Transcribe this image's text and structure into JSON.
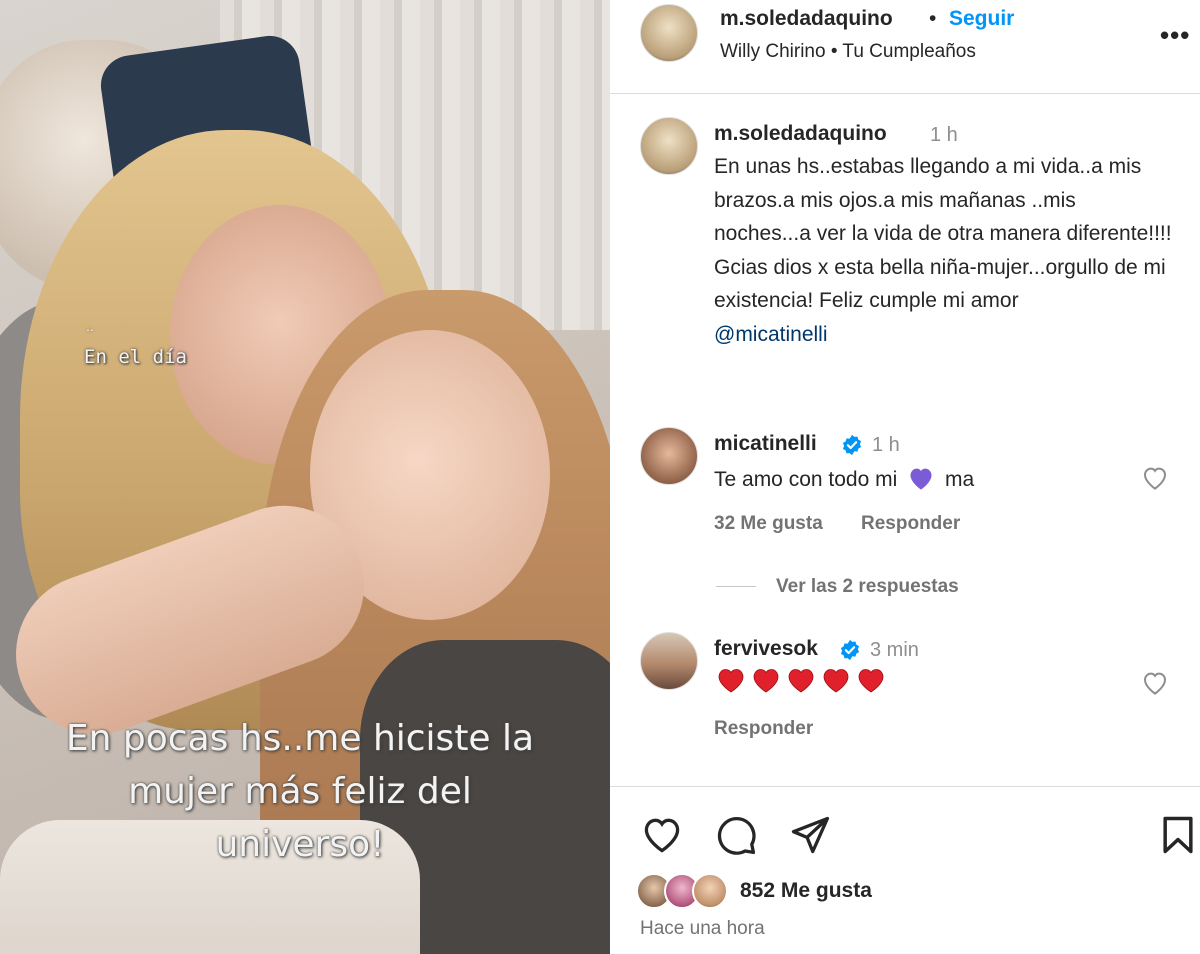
{
  "photo": {
    "tag_dots": "..",
    "tag_text": "En el día",
    "caption_lines": [
      "En pocas hs..me hiciste la",
      "mujer más feliz del",
      "universo!"
    ]
  },
  "header": {
    "username": "m.soledadaquino",
    "separator": "•",
    "follow_label": "Seguir",
    "music": "Willy Chirino • Tu Cumpleaños",
    "more_label": "•••"
  },
  "caption": {
    "username": "m.soledadaquino",
    "time": "1 h",
    "text": "En unas hs..estabas llegando a mi vida..a mis brazos.a mis ojos.a mis mañanas ..mis noches...a ver la vida de otra manera diferente!!!! Gcias dios x esta bella niña-mujer...orgullo de mi existencia! Feliz cumple mi amor",
    "mention": "@micatinelli"
  },
  "comments": [
    {
      "username": "micatinelli",
      "verified": true,
      "time": "1 h",
      "text_before": "Te amo con todo mi",
      "emoji": "purple-heart",
      "text_after": "ma",
      "likes": "32 Me gusta",
      "reply_label": "Responder",
      "view_replies": "Ver las 2 respuestas"
    },
    {
      "username": "fervivesok",
      "verified": true,
      "time": "3 min",
      "emoji": "red-heart x5",
      "reply_label": "Responder"
    }
  ],
  "actions": {
    "like_icon": "heart-icon",
    "comment_icon": "comment-icon",
    "share_icon": "send-icon",
    "save_icon": "bookmark-icon",
    "likes_count": "852 Me gusta",
    "posted_ago": "Hace una hora"
  },
  "colors": {
    "follow_blue": "#0095f6",
    "verified_blue": "#0095f6",
    "mention": "#00376b",
    "muted": "#737373",
    "heart_red": "#e0212b",
    "heart_purple": "#7b5bd6"
  }
}
